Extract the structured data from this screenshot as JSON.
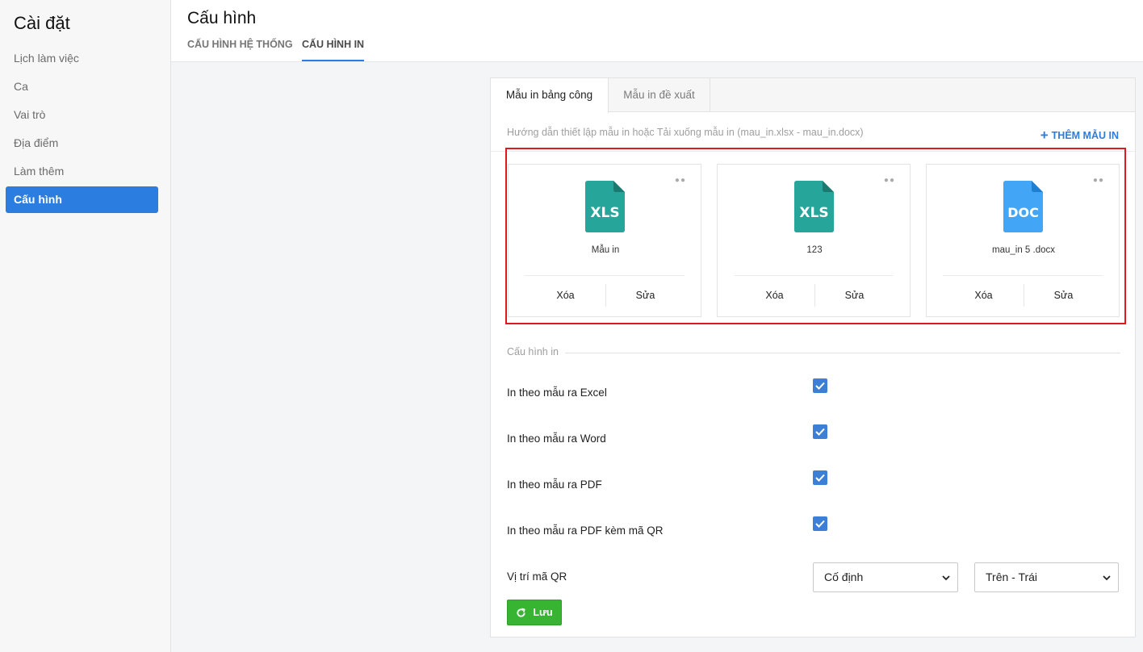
{
  "sidebar": {
    "title": "Cài đặt",
    "items": [
      {
        "label": "Lịch làm việc"
      },
      {
        "label": "Ca"
      },
      {
        "label": "Vai trò"
      },
      {
        "label": "Địa điểm"
      },
      {
        "label": "Làm thêm"
      },
      {
        "label": "Cấu hình",
        "active": true
      }
    ]
  },
  "header": {
    "title": "Cấu hình",
    "tabs": [
      {
        "label": "CẤU HÌNH HỆ THỐNG"
      },
      {
        "label": "CẤU HÌNH IN",
        "active": true
      }
    ]
  },
  "panel": {
    "tabs": [
      {
        "label": "Mẫu in bảng công",
        "active": true
      },
      {
        "label": "Mẫu in đề xuất"
      }
    ],
    "guide_text": "Hướng dẫn thiết lập mẫu in hoặc Tải xuống mẫu in (mau_in.xlsx - mau_in.docx)",
    "add_template_label": "THÊM MẪU IN",
    "templates": [
      {
        "type": "XLS",
        "name": "Mẫu in",
        "delete_label": "Xóa",
        "edit_label": "Sửa",
        "color": "#26a69a"
      },
      {
        "type": "XLS",
        "name": "123",
        "delete_label": "Xóa",
        "edit_label": "Sửa",
        "color": "#26a69a"
      },
      {
        "type": "DOC",
        "name": "mau_in 5 .docx",
        "delete_label": "Xóa",
        "edit_label": "Sửa",
        "color": "#42a5f5"
      }
    ],
    "print_config": {
      "section_label": "Cấu hình in",
      "options": [
        {
          "label": "In theo mẫu ra Excel",
          "checked": true
        },
        {
          "label": "In theo mẫu ra Word",
          "checked": true
        },
        {
          "label": "In theo mẫu ra PDF",
          "checked": true
        },
        {
          "label": "In theo mẫu ra PDF kèm mã QR",
          "checked": true
        }
      ],
      "qr_position_label": "Vị trí mã QR",
      "qr_mode_value": "Cố định",
      "qr_corner_value": "Trên - Trái",
      "save_label": "Lưu"
    }
  },
  "colors": {
    "accent": "#2b7de0",
    "highlight_box": "#e0191e",
    "save_button": "#37b532",
    "xls_icon": "#26a69a",
    "doc_icon": "#42a5f5"
  }
}
